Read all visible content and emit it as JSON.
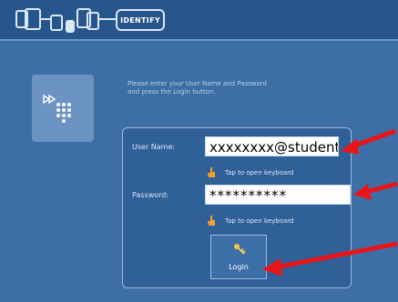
{
  "header": {
    "step_label": "IDENTIFY"
  },
  "instructions": {
    "line1": "Please enter your User Name and Password",
    "line2": "and press the Login button."
  },
  "form": {
    "username_label": "User Name:",
    "username_value": "xxxxxxxx@student",
    "username_hint": "Tap to open keyboard",
    "password_label": "Password:",
    "password_value": "**********",
    "password_hint": "Tap to open keyboard",
    "login_label": "Login"
  },
  "colors": {
    "background": "#3d6fa6",
    "panel": "#2f6098",
    "annotation_arrow": "#e8161b"
  }
}
